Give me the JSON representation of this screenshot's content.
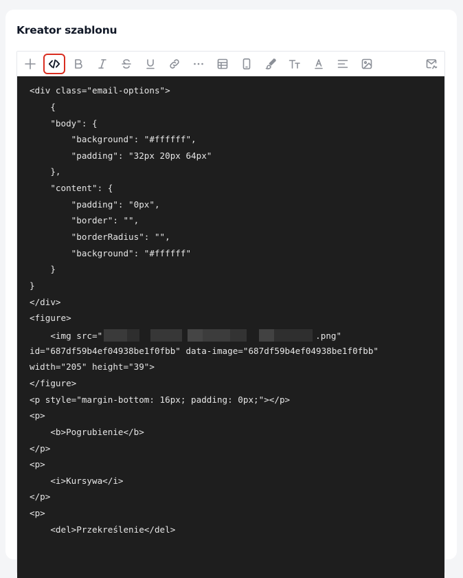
{
  "panel": {
    "title": "Kreator szablonu"
  },
  "toolbar": {
    "items": [
      {
        "name": "add-icon"
      },
      {
        "name": "code-view-icon",
        "active": true
      },
      {
        "name": "bold-icon"
      },
      {
        "name": "italic-icon"
      },
      {
        "name": "strikethrough-icon"
      },
      {
        "name": "underline-icon"
      },
      {
        "name": "link-icon"
      },
      {
        "name": "more-icon"
      },
      {
        "name": "table-icon"
      },
      {
        "name": "mobile-preview-icon"
      },
      {
        "name": "paint-brush-icon"
      },
      {
        "name": "font-size-icon"
      },
      {
        "name": "text-color-icon"
      },
      {
        "name": "align-left-icon"
      },
      {
        "name": "image-icon"
      },
      {
        "name": "email-preview-icon"
      }
    ]
  },
  "code": {
    "lines": [
      "<div class=\"email-options\">",
      "    {",
      "    \"body\": {",
      "        \"background\": \"#ffffff\",",
      "        \"padding\": \"32px 20px 64px\"",
      "    },",
      "    \"content\": {",
      "        \"padding\": \"0px\",",
      "        \"border\": \"\",",
      "        \"borderRadius\": \"\",",
      "        \"background\": \"#ffffff\"",
      "    }",
      "}",
      "</div>",
      "<figure>",
      "    <img src=\"",
      "id=\"687df59b4ef04938be1f0fbb\" data-image=\"687df59b4ef04938be1f0fbb\"",
      "width=\"205\" height=\"39\">",
      "</figure>",
      "<p style=\"margin-bottom: 16px; padding: 0px;\"></p>",
      "<p>",
      "    <b>Pogrubienie</b>",
      "</p>",
      "<p>",
      "    <i>Kursywa</i>",
      "</p>",
      "<p>",
      "    <del>Przekreślenie</del>"
    ],
    "img_src_suffix": ".png\""
  },
  "colors": {
    "active_border": "#d92d20",
    "code_bg": "#1e1e1e",
    "code_text": "#e6e6e6"
  }
}
